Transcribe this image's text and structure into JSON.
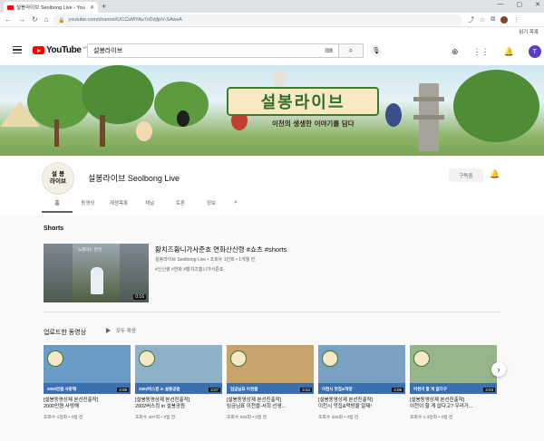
{
  "browser": {
    "tab_title": "설봉라이브 Seolbong Live - You",
    "url": "youtube.com/channel/UCCuMYAu7sDzjljoV-SAwsA",
    "reading_list": "읽기 목록"
  },
  "yt": {
    "logo_text": "YouTube",
    "region": "KR",
    "search_query": "설봉라이브",
    "avatar_letter": "T"
  },
  "banner": {
    "title": "설봉라이브",
    "tagline": "이천의 생생한 이야기를 담다"
  },
  "channel": {
    "logo_line1": "설 봉",
    "logo_line2": "라이브",
    "name": "설봉라이브 Seolbong Live",
    "subscribe_label": "구독중",
    "tabs": [
      "홈",
      "동영상",
      "재생목록",
      "채널",
      "토론",
      "정보"
    ]
  },
  "shorts": {
    "heading": "Shorts",
    "thumb_caption": "노래하는 만인",
    "duration": "0:16",
    "title": "황치즈황니가사준쵸 연화산신령 #쇼츠 #shorts",
    "meta": "설봉라이브 Seolbong Live • 조회수 1만회 • 1개월 전",
    "tags": "#신신령 #연화 #황치즈황니가사준쵸"
  },
  "uploads": {
    "heading": "업로드한 동영상",
    "play_all": "모두 재생",
    "videos": [
      {
        "label": "2000만큼 사랑해",
        "duration": "3:08",
        "title_line1": "[설봉동영상제 본선진출작]",
        "title_line2": "2000만큼 사랑해",
        "meta": "조회수 1천회 • 3일 전",
        "color": "#6b9cc8"
      },
      {
        "label": "2002버스킹 in 설봉공원",
        "duration": "3:07",
        "title_line1": "[설봉동영상제 본선진출작]",
        "title_line2": "2002버스킹 in 설봉공원",
        "meta": "조회수 407회 • 3일 전",
        "color": "#8fb0c9"
      },
      {
        "label": "임금님표 이천쌀",
        "duration": "3:03",
        "title_line1": "[설봉동영상제 본선진출작]",
        "title_line2": "임금님표 이천쌀-서희 선생...",
        "meta": "조회수 333회 • 3일 전",
        "color": "#c9a36b"
      },
      {
        "label": "이천시 맛집&먹방",
        "duration": "4:08",
        "title_line1": "[설봉동영상제 본선진출작]",
        "title_line2": "이천시 맛집&먹방을 알제!",
        "meta": "조회수 325회 • 3일 전",
        "color": "#7aa0c4"
      },
      {
        "label": "이천이 할 게 없다구",
        "duration": "3:03",
        "title_line1": "[설봉동영상제 본선진출작]",
        "title_line2": "이천이 할 게 없다고? 우리가...",
        "meta": "조회수 1.3천회 • 3일 전",
        "color": "#96b58a"
      }
    ]
  },
  "colors": {
    "youtube_red": "#ff0000",
    "banner_green": "#2f6f2a",
    "banner_frame": "#f7e9c4",
    "avatar": "#5c3fc4"
  }
}
